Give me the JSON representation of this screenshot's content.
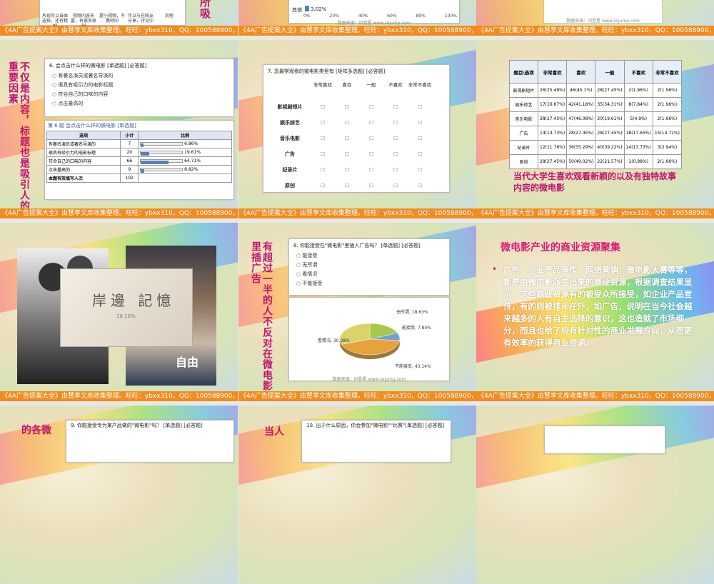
{
  "footer": "《4A广告提案大全》由慧享文库收集整理。旺旺：ybxx310，QQ：100588900，89988368",
  "s1": {
    "cols": [
      "片现可以自由选择，还有精剧",
      "视频内容丰富，有很多原创",
      "提小视频，不费时间",
      "可以与在网友分享，讨论中",
      "其他"
    ],
    "side": "所吸"
  },
  "s2": {
    "label": "其他",
    "pct": "3.02%",
    "ticks": [
      "0%",
      "20%",
      "40%",
      "60%",
      "80%",
      "100%"
    ],
    "src": "数据来源：问卷星 www.sojump.com"
  },
  "s3": {
    "src": "数据来源：问卷星 www.sojump.com"
  },
  "s4": {
    "side": "不仅是内容，标题也是吸引人的重要因素",
    "q": "6. 会点击什么样的微电影 [单选题] [必答题]",
    "opts": [
      "有著名演员或著名导演的",
      "很具有吸引力的电影标题",
      "符合自己的口味的内容",
      "点击量高的"
    ],
    "table_title": "第 6 题  会点击什么样的微电影  [单选题]",
    "hdr": [
      "选项",
      "小计",
      "比例"
    ],
    "rows": [
      {
        "o": "有著名演员或著名导演的",
        "n": "7",
        "p": "6.86%",
        "v": 6.86
      },
      {
        "o": "很具有吸引力的电影标题",
        "n": "20",
        "p": "19.61%",
        "v": 19.61
      },
      {
        "o": "符合自己的口味的内容",
        "n": "66",
        "p": "64.71%",
        "v": 64.71
      },
      {
        "o": "点击量高的",
        "n": "9",
        "p": "8.82%",
        "v": 8.82
      }
    ],
    "total": "本题有效填写人次",
    "total_n": "102"
  },
  "s5": {
    "q": "7. 您最常观看的微电影类型有 [矩阵多选题] [必答题]",
    "cols": [
      "非常喜欢",
      "喜欢",
      "一般",
      "不喜欢",
      "非常不喜欢"
    ],
    "rows": [
      "影视剧短片",
      "娱乐综艺",
      "音乐电影",
      "广告",
      "纪录片",
      "原创"
    ]
  },
  "s6": {
    "hdr": [
      "题目\\选项",
      "非常喜欢",
      "喜欢",
      "一般",
      "不喜欢",
      "非常不喜欢"
    ],
    "rows": [
      [
        "影视剧短片",
        "26(25.49%)",
        "46(45.1%)",
        "28(27.45%)",
        "2(1.96%)",
        "2(1.96%)"
      ],
      [
        "娱乐综艺",
        "17(16.67%)",
        "42(41.18%)",
        "35(34.31%)",
        "8(7.84%)",
        "2(1.96%)"
      ],
      [
        "音乐电影",
        "28(27.45%)",
        "47(46.08%)",
        "20(19.61%)",
        "5(4.9%)",
        "2(1.96%)"
      ],
      [
        "广告",
        "14(13.73%)",
        "28(27.45%)",
        "28(27.45%)",
        "18(17.65%)",
        "15(14.71%)"
      ],
      [
        "纪录片",
        "12(11.76%)",
        "36(35.29%)",
        "40(39.22%)",
        "14(13.73%)",
        "3(2.94%)"
      ],
      [
        "原创",
        "28(27.45%)",
        "50(49.02%)",
        "22(21.57%)",
        "1(0.98%)",
        "2(1.96%)"
      ]
    ],
    "caption": "当代大学生喜欢观看新颖的以及有独特故事内容的微电影"
  },
  "s7": {
    "poster_text": "岸邊 記憶",
    "poster_sub": "10.10%",
    "right_text": "自由"
  },
  "s8": {
    "side": "有超过一半的人不反对在微电影里插广告",
    "q": "8. 你能接受在\"微电影\"里插入广告吗？ [单选题] [必答题]",
    "opts": [
      "能接受",
      "无所谓",
      "看情况",
      "不能接受"
    ],
    "pie": [
      {
        "name": "无所谓",
        "pct": "18.63%",
        "v": 18.63,
        "c": "#a7c94a"
      },
      {
        "name": "能接受",
        "pct": "7.84%",
        "v": 7.84,
        "c": "#6fa0d8"
      },
      {
        "name": "不能接受",
        "pct": "43.14%",
        "v": 43.14,
        "c": "#e7a23c"
      },
      {
        "name": "看情况",
        "pct": "30.39%",
        "v": 30.39,
        "c": "#d9d36a"
      }
    ],
    "pie_labels": [
      "无所谓, 18.63%",
      "能接受, 7.84%",
      "不能接受, 43.14%",
      "看情况, 30.39%"
    ],
    "src": "数据来源：问卷星 www.sojump.com"
  },
  "s9": {
    "title": "微电影产业的商业资源聚集",
    "body": "广告，企业产品宣传，网络营销，微电影大赛等等，都是由微电影派生出来的商业资源，根据调查结果显示，这些商业资源有的被受众所接受，如企业产品宣传，有的则被排斥在外，如广告，说明在当今社会越来越多的人有自主选择的意识，这也造就了市场细分，而且也给了较有针对性的商业发展方向，从而更有效率的获得商业资源。"
  },
  "s10": {
    "side": "的各微",
    "q": "9. 你能接受专为某产品做的\"微电影\"吗？ [单选题] [必答题]"
  },
  "s11": {
    "side": "当人",
    "q": "10. 出于什么原因，你会参加\"微电影\"\"比赛\"[单选题] [必答题]"
  }
}
